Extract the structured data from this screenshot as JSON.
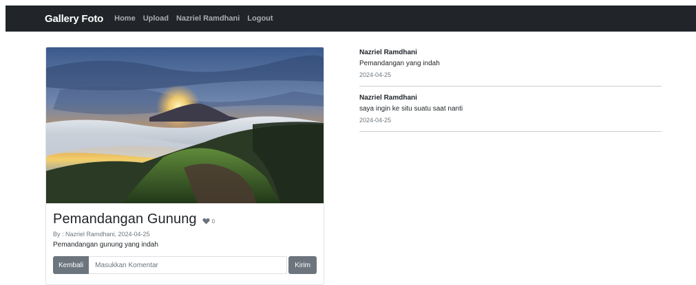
{
  "navbar": {
    "brand": "Gallery Foto",
    "links": [
      "Home",
      "Upload",
      "Nazriel Ramdhani",
      "Logout"
    ]
  },
  "photo": {
    "title": "Pemandangan Gunung",
    "likes": "0",
    "byline": "By : Nazriel Ramdhani, 2024-04-25",
    "description": "Pemandangan gunung yang indah",
    "like_icon": "heart-icon"
  },
  "comment_form": {
    "back_label": "Kembali",
    "placeholder": "Masukkan Komentar",
    "send_label": "Kirim"
  },
  "comments": [
    {
      "author": "Nazriel Ramdhani",
      "text": "Pemandangan yang indah",
      "date": "2024-04-25"
    },
    {
      "author": "Nazriel Ramdhani",
      "text": "saya ingin ke situ suatu saat nanti",
      "date": "2024-04-25"
    }
  ],
  "colors": {
    "navbar_bg": "#212529",
    "button_bg": "#6c757d",
    "muted_text": "#6c757d"
  }
}
